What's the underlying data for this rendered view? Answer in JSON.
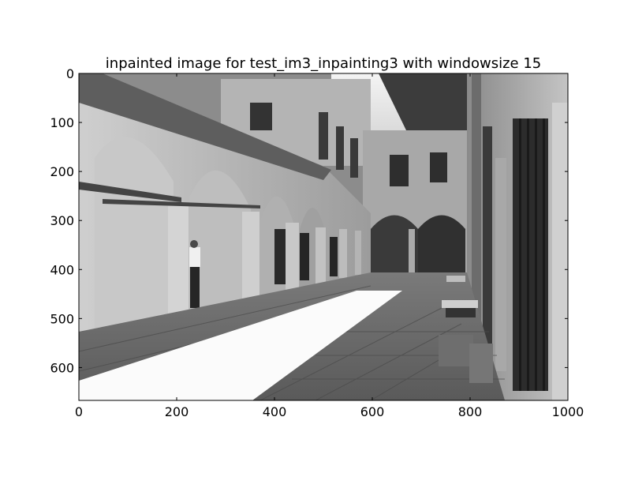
{
  "chart_data": {
    "type": "image",
    "title": "inpainted image for test_im3_inpainting3 with windowsize 15",
    "x_ticks": [
      0,
      200,
      400,
      600,
      800,
      1000
    ],
    "y_ticks": [
      0,
      100,
      200,
      300,
      400,
      500,
      600
    ],
    "xlim": [
      0,
      1000
    ],
    "ylim": [
      667,
      0
    ],
    "colormap": "grayscale",
    "grid": false
  }
}
